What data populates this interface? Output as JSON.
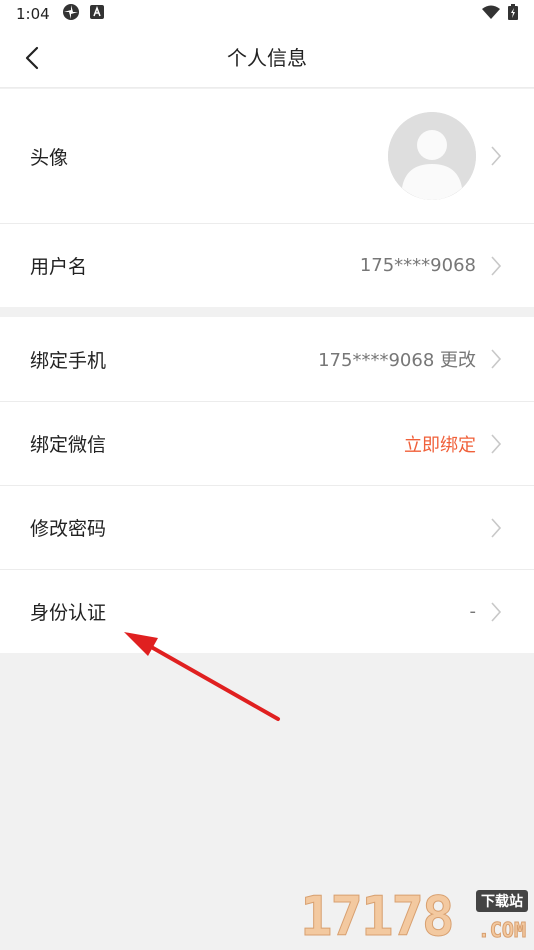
{
  "status_bar": {
    "time": "1:04",
    "icons": [
      "pinwheel-icon",
      "a-badge-icon"
    ],
    "right_icons": [
      "wifi-icon",
      "battery-icon"
    ]
  },
  "header": {
    "title": "个人信息",
    "back_icon": "chevron-left-icon"
  },
  "group1": {
    "avatar_label": "头像",
    "username_label": "用户名",
    "username_value": "175****9068"
  },
  "group2": {
    "phone_label": "绑定手机",
    "phone_value": "175****9068 更改",
    "wechat_label": "绑定微信",
    "wechat_value": "立即绑定",
    "password_label": "修改密码",
    "identity_label": "身份认证",
    "identity_value": "-"
  },
  "watermark": {
    "digits": "17178",
    "tag": "下载站",
    "domain": ".COM"
  },
  "colors": {
    "accent": "#f0603a",
    "annotation_arrow": "#e02020",
    "background": "#f1f1f1"
  }
}
